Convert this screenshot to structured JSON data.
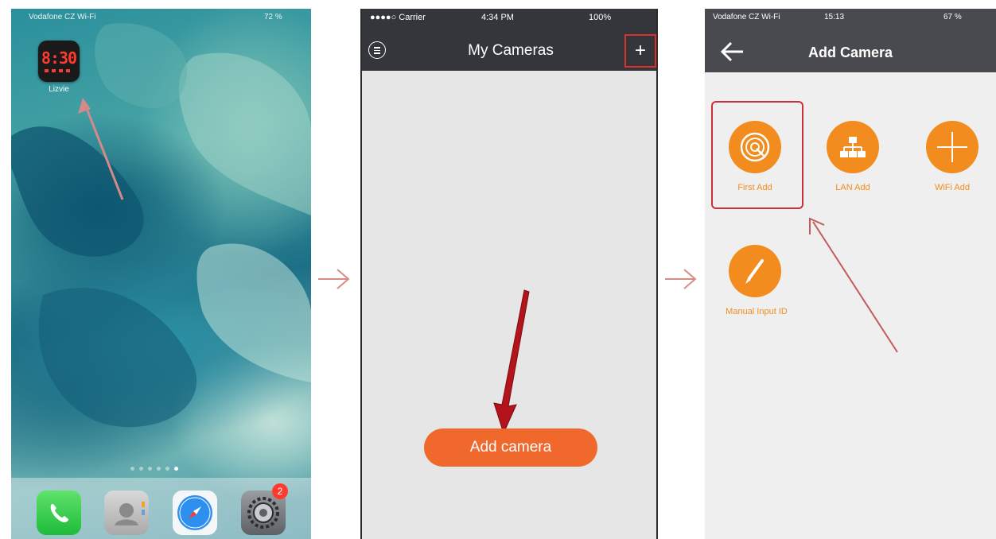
{
  "panel1": {
    "status": {
      "carrier": "Vodafone CZ Wi-Fi",
      "battery": "72 %"
    },
    "app": {
      "name": "Lizvie",
      "icon_text": "8:30",
      "icon": "clock-app-icon"
    },
    "dock": [
      {
        "name": "phone",
        "icon": "phone-icon"
      },
      {
        "name": "contacts",
        "icon": "contacts-icon"
      },
      {
        "name": "safari",
        "icon": "compass-icon"
      },
      {
        "name": "settings",
        "icon": "gear-icon"
      }
    ],
    "settings_badge": "2",
    "page_dots": 6,
    "active_page_dot": 6
  },
  "panel2": {
    "status": {
      "carrier": "●●●●○ Carrier",
      "time": "4:34 PM",
      "battery": "100%"
    },
    "title": "My Cameras",
    "add_icon": "+",
    "menu_icon": "menu-icon",
    "add_camera_button": "Add camera"
  },
  "panel3": {
    "status": {
      "carrier": "Vodafone CZ Wi-Fi",
      "time": "15:13",
      "battery": "67 %"
    },
    "title": "Add Camera",
    "options": [
      {
        "label": "First Add",
        "icon": "radar-icon"
      },
      {
        "label": "LAN Add",
        "icon": "network-icon"
      },
      {
        "label": "WiFi Add",
        "icon": "plus-icon"
      },
      {
        "label": "Manual Input ID",
        "icon": "pen-icon"
      }
    ]
  },
  "colors": {
    "accent_orange": "#f28c1e",
    "button_orange": "#f0682c",
    "highlight_red": "#c9303a",
    "navbar_dark": "#34363b"
  }
}
